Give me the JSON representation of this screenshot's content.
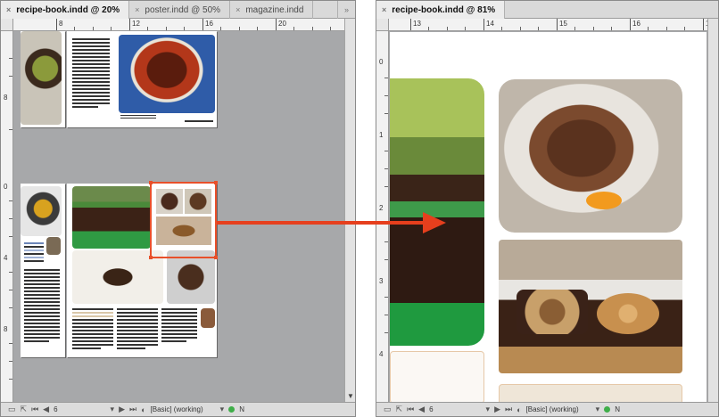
{
  "left_window": {
    "tabs": [
      {
        "label": "recipe-book.indd @ 20%",
        "active": true
      },
      {
        "label": "poster.indd @ 50%",
        "active": false
      },
      {
        "label": "magazine.indd",
        "active": false
      }
    ],
    "more_tabs_label": "»",
    "ruler_h": [
      "8",
      "12",
      "16",
      "20"
    ],
    "ruler_v_top": [
      "8"
    ],
    "ruler_v_bottom": [
      "0",
      "4",
      "8"
    ],
    "status": {
      "page": "6",
      "style": "[Basic] (working)",
      "error_count": "N"
    }
  },
  "right_window": {
    "tabs": [
      {
        "label": "recipe-book.indd @ 81%",
        "active": true
      }
    ],
    "ruler_h": [
      "13",
      "14",
      "15",
      "16",
      "17"
    ],
    "ruler_v": [
      "0",
      "1",
      "2",
      "3",
      "4"
    ],
    "status": {
      "page": "6",
      "style": "[Basic] (working)",
      "error_count": "N"
    }
  },
  "colors": {
    "accent": "#e63f1d",
    "pasteboard": "#a7a8aa"
  },
  "icons": {
    "close": "close-icon",
    "first_page": "first-page-icon",
    "prev_page": "prev-page-icon",
    "next_page": "next-page-icon",
    "preflight": "preflight-icon"
  }
}
